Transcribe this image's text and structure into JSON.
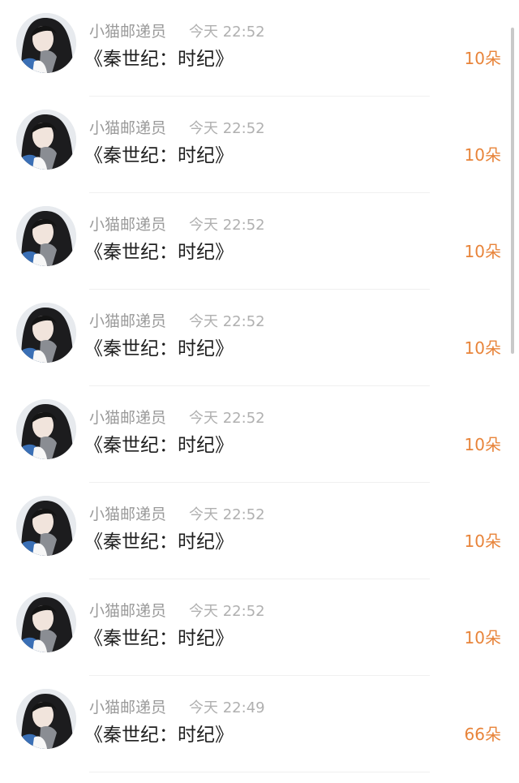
{
  "messages": [
    {
      "sender": "小猫邮递员",
      "time": "今天 22:52",
      "title": "《秦世纪：时纪》",
      "amount": "10朵"
    },
    {
      "sender": "小猫邮递员",
      "time": "今天 22:52",
      "title": "《秦世纪：时纪》",
      "amount": "10朵"
    },
    {
      "sender": "小猫邮递员",
      "time": "今天 22:52",
      "title": "《秦世纪：时纪》",
      "amount": "10朵"
    },
    {
      "sender": "小猫邮递员",
      "time": "今天 22:52",
      "title": "《秦世纪：时纪》",
      "amount": "10朵"
    },
    {
      "sender": "小猫邮递员",
      "time": "今天 22:52",
      "title": "《秦世纪：时纪》",
      "amount": "10朵"
    },
    {
      "sender": "小猫邮递员",
      "time": "今天 22:52",
      "title": "《秦世纪：时纪》",
      "amount": "10朵"
    },
    {
      "sender": "小猫邮递员",
      "time": "今天 22:52",
      "title": "《秦世纪：时纪》",
      "amount": "10朵"
    },
    {
      "sender": "小猫邮递员",
      "time": "今天 22:49",
      "title": "《秦世纪：时纪》",
      "amount": "66朵"
    }
  ],
  "colors": {
    "amount": "#e8843a",
    "sender": "#9a9a9a",
    "time": "#b0b0b0",
    "title": "#1f1f1f"
  }
}
